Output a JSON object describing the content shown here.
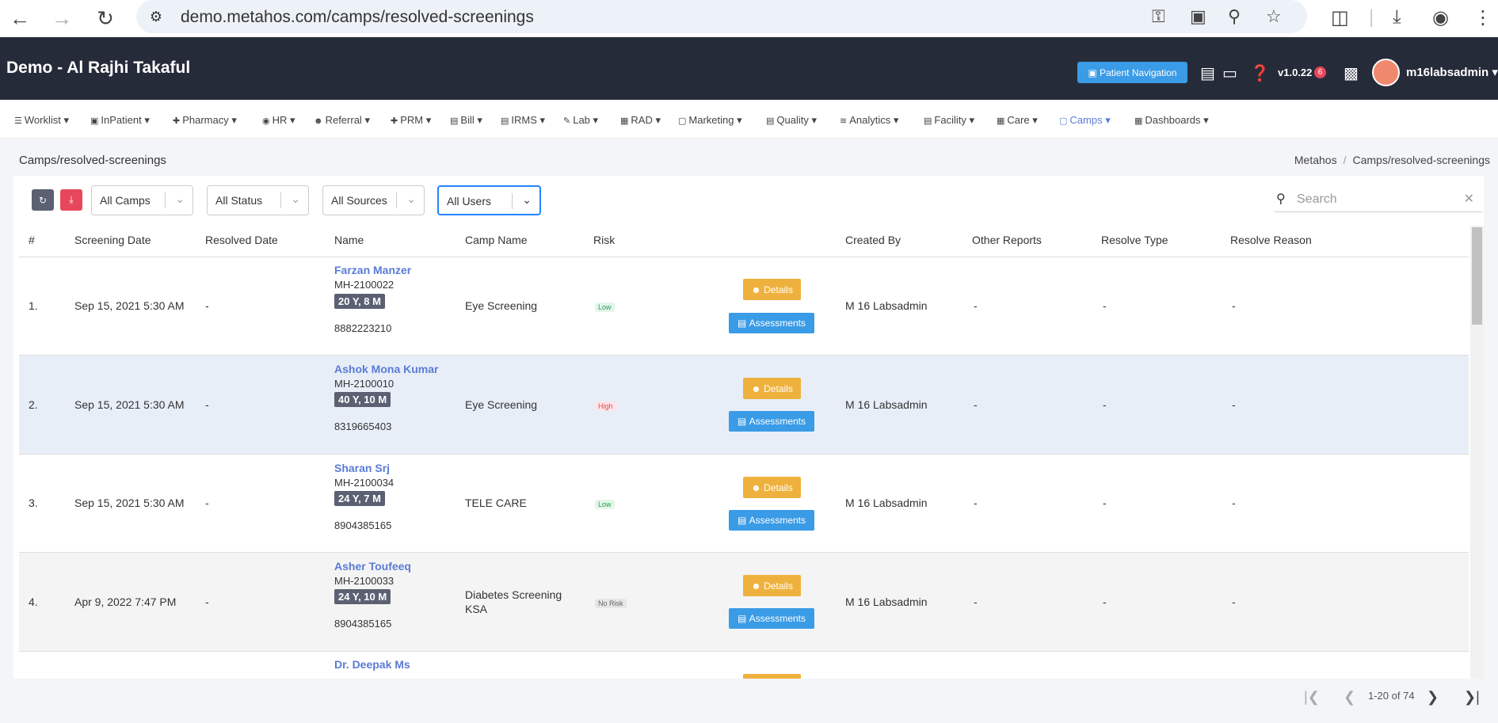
{
  "browser": {
    "url": "demo.metahos.com/camps/resolved-screenings"
  },
  "header": {
    "title": "Demo - Al Rajhi Takaful",
    "patient_navigation": "Patient Navigation",
    "version": "v1.0.22",
    "notification_count": "6",
    "username": "m16labsadmin"
  },
  "menu": [
    "Worklist",
    "InPatient",
    "Pharmacy",
    "HR",
    "Referral",
    "PRM",
    "Bill",
    "IRMS",
    "Lab",
    "RAD",
    "Marketing",
    "Quality",
    "Analytics",
    "Facility",
    "Care",
    "Camps",
    "Dashboards"
  ],
  "breadcrumb": {
    "page": "Camps/resolved-screenings",
    "root": "Metahos",
    "current": "Camps/resolved-screenings"
  },
  "filters": {
    "camps": "All Camps",
    "status": "All Status",
    "sources": "All Sources",
    "users": "All Users",
    "search_placeholder": "Search"
  },
  "table": {
    "headers": [
      "#",
      "Screening Date",
      "Resolved Date",
      "Name",
      "Camp Name",
      "Risk",
      "Created By",
      "Other Reports",
      "Resolve Type",
      "Resolve Reason"
    ],
    "details_label": "Details",
    "assessments_label": "Assessments",
    "rows": [
      {
        "num": "1.",
        "screening_date": "Sep 15, 2021 5:30 AM",
        "resolved_date": "-",
        "name": "Farzan Manzer",
        "mrn": "MH-2100022",
        "age": "20 Y, 8 M",
        "phone": "8882223210",
        "camp": "Eye Screening",
        "camp2": "",
        "risk": "Low",
        "created_by": "M 16 Labsadmin",
        "other_reports": "-",
        "resolve_type": "-",
        "resolve_reason": "-"
      },
      {
        "num": "2.",
        "screening_date": "Sep 15, 2021 5:30 AM",
        "resolved_date": "-",
        "name": "Ashok Mona Kumar",
        "mrn": "MH-2100010",
        "age": "40 Y, 10 M",
        "phone": "8319665403",
        "camp": "Eye Screening",
        "camp2": "",
        "risk": "High",
        "created_by": "M 16 Labsadmin",
        "other_reports": "-",
        "resolve_type": "-",
        "resolve_reason": "-"
      },
      {
        "num": "3.",
        "screening_date": "Sep 15, 2021 5:30 AM",
        "resolved_date": "-",
        "name": "Sharan Srj",
        "mrn": "MH-2100034",
        "age": "24 Y, 7 M",
        "phone": "8904385165",
        "camp": "TELE CARE",
        "camp2": "",
        "risk": "Low",
        "created_by": "M 16 Labsadmin",
        "other_reports": "-",
        "resolve_type": "-",
        "resolve_reason": "-"
      },
      {
        "num": "4.",
        "screening_date": "Apr 9, 2022 7:47 PM",
        "resolved_date": "-",
        "name": "Asher Toufeeq",
        "mrn": "MH-2100033",
        "age": "24 Y, 10 M",
        "phone": "8904385165",
        "camp": "Diabetes Screening",
        "camp2": "KSA",
        "risk": "No Risk",
        "created_by": "M 16 Labsadmin",
        "other_reports": "-",
        "resolve_type": "-",
        "resolve_reason": "-"
      },
      {
        "name": "Dr. Deepak Ms"
      }
    ]
  },
  "pagination": {
    "info": "1-20 of 74"
  }
}
